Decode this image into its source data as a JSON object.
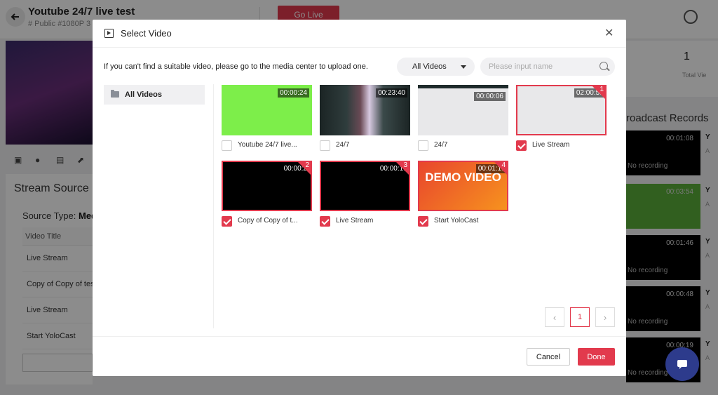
{
  "page": {
    "title": "Youtube 24/7 live test",
    "subtitle": "# Public #1080P 3",
    "go_live_label": "Go Live"
  },
  "stream_source": {
    "title": "Stream Source",
    "source_type_label": "Source Type:",
    "source_type_value": "Med",
    "column_header": "Video Title",
    "rows": [
      "Live Stream",
      "Copy of Copy of tes",
      "Live Stream",
      "Start YoloCast"
    ]
  },
  "stats": {
    "value": "1",
    "label": "Total Vie"
  },
  "broadcast": {
    "title": "roadcast Records",
    "records": [
      {
        "duration": "00:01:08",
        "status": "No recording",
        "thumb_color": "#000000",
        "initial": "Y",
        "line": "A"
      },
      {
        "duration": "00:03:54",
        "status": "",
        "thumb_color": "#5aad3a",
        "initial": "Y",
        "line": "A"
      },
      {
        "duration": "00:01:46",
        "status": "No recording",
        "thumb_color": "#000000",
        "initial": "Y",
        "line": "A"
      },
      {
        "duration": "00:00:48",
        "status": "No recording",
        "thumb_color": "#000000",
        "initial": "Y",
        "line": "A"
      },
      {
        "duration": "00:00:19",
        "status": "No recording",
        "thumb_color": "#000000",
        "initial": "Y",
        "line": "A"
      }
    ]
  },
  "modal": {
    "title": "Select Video",
    "hint": "If you can't find a suitable video, please go to the media center to upload one.",
    "filter_value": "All Videos",
    "search_placeholder": "Please input name",
    "sidebar": {
      "item": "All Videos"
    },
    "videos": [
      {
        "title": "Youtube 24/7 live...",
        "duration": "00:00:24",
        "selected": false,
        "order": "",
        "thumb": "#7dee4a"
      },
      {
        "title": "24/7",
        "duration": "00:23:40",
        "selected": false,
        "order": "",
        "thumb": "#2d3a3a"
      },
      {
        "title": "24/7",
        "duration": "00:00:06",
        "selected": false,
        "order": "",
        "thumb": "#e8e8ea"
      },
      {
        "title": "Live Stream",
        "duration": "02:00:5:",
        "selected": true,
        "order": "1",
        "thumb": "#e8e8ea"
      },
      {
        "title": "Copy of Copy of t...",
        "duration": "00:00:2",
        "selected": true,
        "order": "2",
        "thumb": "#000000"
      },
      {
        "title": "Live Stream",
        "duration": "00:00:1:",
        "selected": true,
        "order": "3",
        "thumb": "#000000"
      },
      {
        "title": "Start YoloCast",
        "duration": "00:01:1:",
        "selected": true,
        "order": "4",
        "thumb": "#f06a2a",
        "overlay_text": "DEMO VIDEO"
      }
    ],
    "pagination": {
      "prev": "‹",
      "page": "1",
      "next": "›"
    },
    "cancel_label": "Cancel",
    "done_label": "Done"
  },
  "colors": {
    "accent": "#e23a4d",
    "chat": "#2d3b8c"
  }
}
